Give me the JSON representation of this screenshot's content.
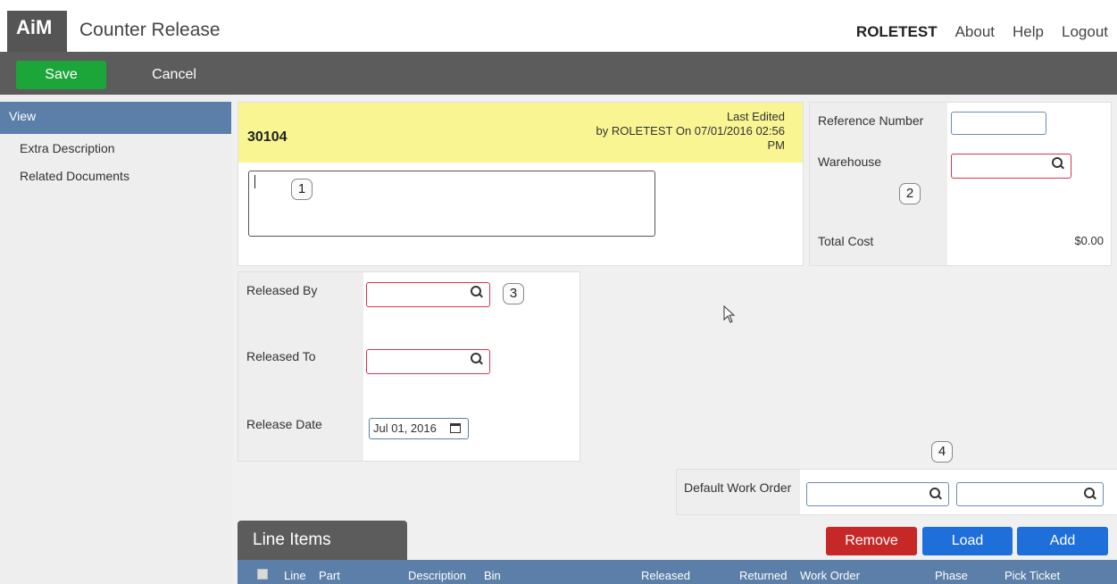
{
  "header": {
    "logo": "AiM",
    "title": "Counter Release",
    "user": "ROLETEST",
    "nav": [
      "About",
      "Help",
      "Logout"
    ]
  },
  "toolbar": {
    "save_label": "Save",
    "cancel_label": "Cancel"
  },
  "sidebar": {
    "items": [
      {
        "label": "View"
      },
      {
        "label": "Extra Description"
      },
      {
        "label": "Related Documents"
      }
    ]
  },
  "record": {
    "id": "30104",
    "last_edited_line1": "Last Edited",
    "last_edited_line2": "by ROLETEST On 07/01/2016 02:56",
    "last_edited_line3": "PM",
    "description": ""
  },
  "reference": {
    "reference_number_label": "Reference Number",
    "warehouse_label": "Warehouse",
    "total_cost_label": "Total Cost",
    "total_cost_value": "$0.00"
  },
  "release": {
    "released_by_label": "Released By",
    "released_to_label": "Released To",
    "release_date_label": "Release Date",
    "release_date_value": "Jul 01, 2016"
  },
  "default_work_order": {
    "label": "Default Work Order"
  },
  "callouts": [
    "1",
    "2",
    "3",
    "4"
  ],
  "line_items": {
    "title": "Line Items",
    "remove_label": "Remove",
    "load_label": "Load",
    "add_label": "Add",
    "columns": [
      "Line",
      "Part",
      "Description",
      "Bin",
      "Released",
      "Returned",
      "Work Order",
      "Phase",
      "Pick Ticket"
    ]
  }
}
